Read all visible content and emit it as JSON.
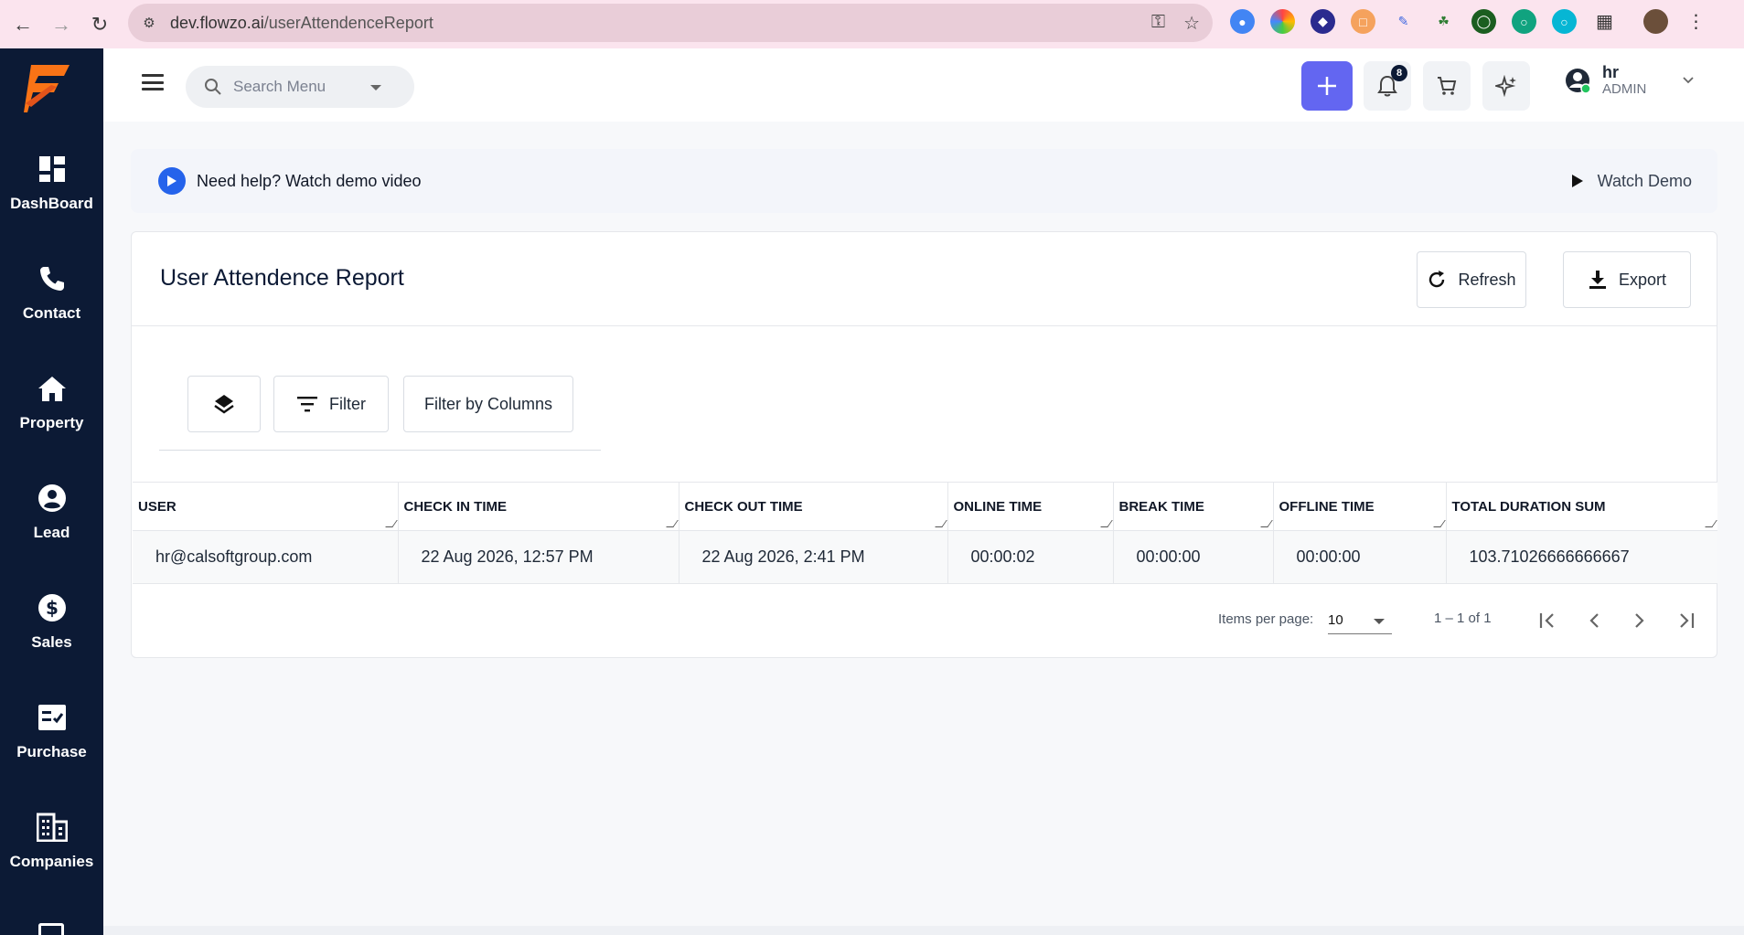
{
  "browser": {
    "url_host": "dev.flowzo.ai",
    "url_path": "/userAttendenceReport"
  },
  "sidebar": {
    "items": [
      {
        "label": "DashBoard",
        "icon": "dashboard-icon"
      },
      {
        "label": "Contact",
        "icon": "phone-icon"
      },
      {
        "label": "Property",
        "icon": "home-icon"
      },
      {
        "label": "Lead",
        "icon": "person-circle-icon"
      },
      {
        "label": "Sales",
        "icon": "dollar-icon"
      },
      {
        "label": "Purchase",
        "icon": "checklist-icon"
      },
      {
        "label": "Companies",
        "icon": "building-icon"
      }
    ]
  },
  "header": {
    "search_placeholder": "Search Menu",
    "notification_count": "8",
    "user_name": "hr",
    "user_role": "ADMIN"
  },
  "help": {
    "text": "Need help? Watch demo video",
    "demo_label": "Watch Demo"
  },
  "report": {
    "title": "User Attendence Report",
    "refresh_label": "Refresh",
    "export_label": "Export",
    "filter_label": "Filter",
    "filter_columns_label": "Filter by Columns",
    "columns": [
      "USER",
      "CHECK IN TIME",
      "CHECK OUT TIME",
      "ONLINE TIME",
      "BREAK TIME",
      "OFFLINE TIME",
      "TOTAL DURATION SUM"
    ],
    "rows": [
      [
        "hr@calsoftgroup.com",
        "22 Aug 2026, 12:57 PM",
        "22 Aug 2026, 2:41 PM",
        "00:00:02",
        "00:00:00",
        "00:00:00",
        "103.71026666666667"
      ]
    ],
    "pagination": {
      "items_per_page_label": "Items per page:",
      "items_per_page": "10",
      "range": "1 – 1 of 1"
    }
  },
  "colors": {
    "sidebar_bg": "#0c1a35",
    "accent": "#6366f1",
    "brand": "#f97316",
    "play": "#2563eb"
  }
}
